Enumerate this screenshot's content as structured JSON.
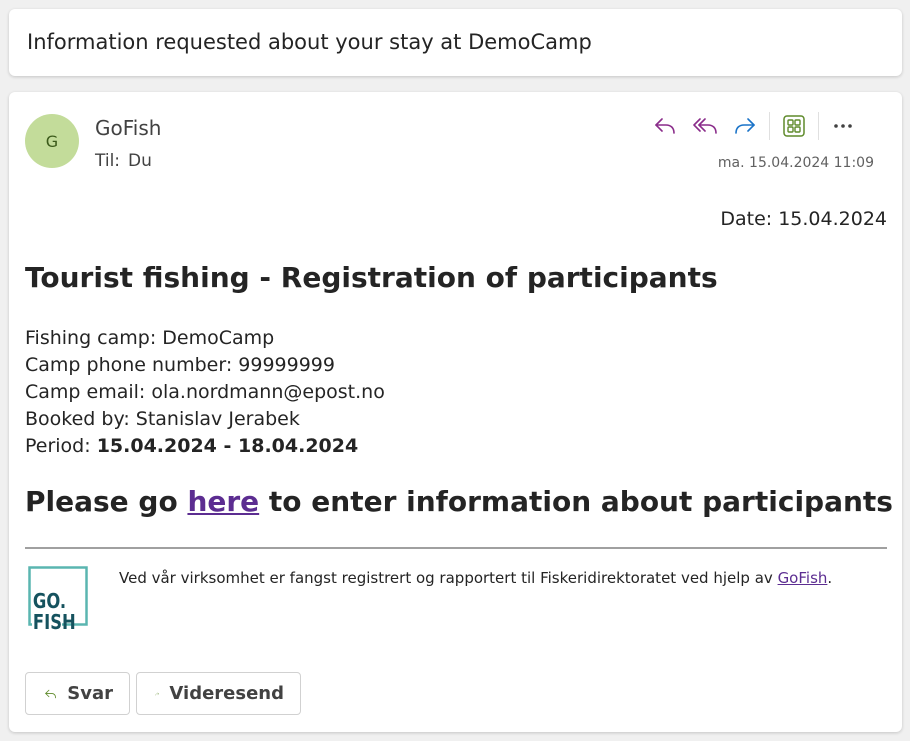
{
  "subject": "Information requested about your stay at DemoCamp",
  "header": {
    "avatar_initial": "G",
    "sender": "GoFish",
    "to_label": "Til:",
    "to_value": "Du",
    "datetime": "ma. 15.04.2024 11:09",
    "actions": [
      "reply",
      "reply-all",
      "forward",
      "apps",
      "more"
    ],
    "colors": {
      "reply": "#8a2c8a",
      "forward": "#1a73c8",
      "apps": "#5e8a2a"
    }
  },
  "body": {
    "date": "Date: 15.04.2024",
    "title": "Tourist fishing - Registration of participants",
    "fishing_camp": "Fishing camp: DemoCamp",
    "camp_phone": "Camp phone number: 99999999",
    "camp_email": "Camp email: ola.nordmann@epost.no",
    "booked_by": "Booked by: Stanislav Jerabek",
    "period_label": "Period:",
    "period_value": "15.04.2024 - 18.04.2024",
    "please_prefix": "Please go",
    "please_link": "here",
    "please_suffix": "to enter information about participants",
    "logo_line1": "GO.",
    "logo_line2": "FISH",
    "footer_text": "Ved vår virksomhet er fangst registrert og rapportert til Fiskeridirektoratet ved hjelp av",
    "footer_link": "GoFish",
    "footer_end": "."
  },
  "buttons": {
    "reply": "Svar",
    "forward": "Videresend"
  }
}
